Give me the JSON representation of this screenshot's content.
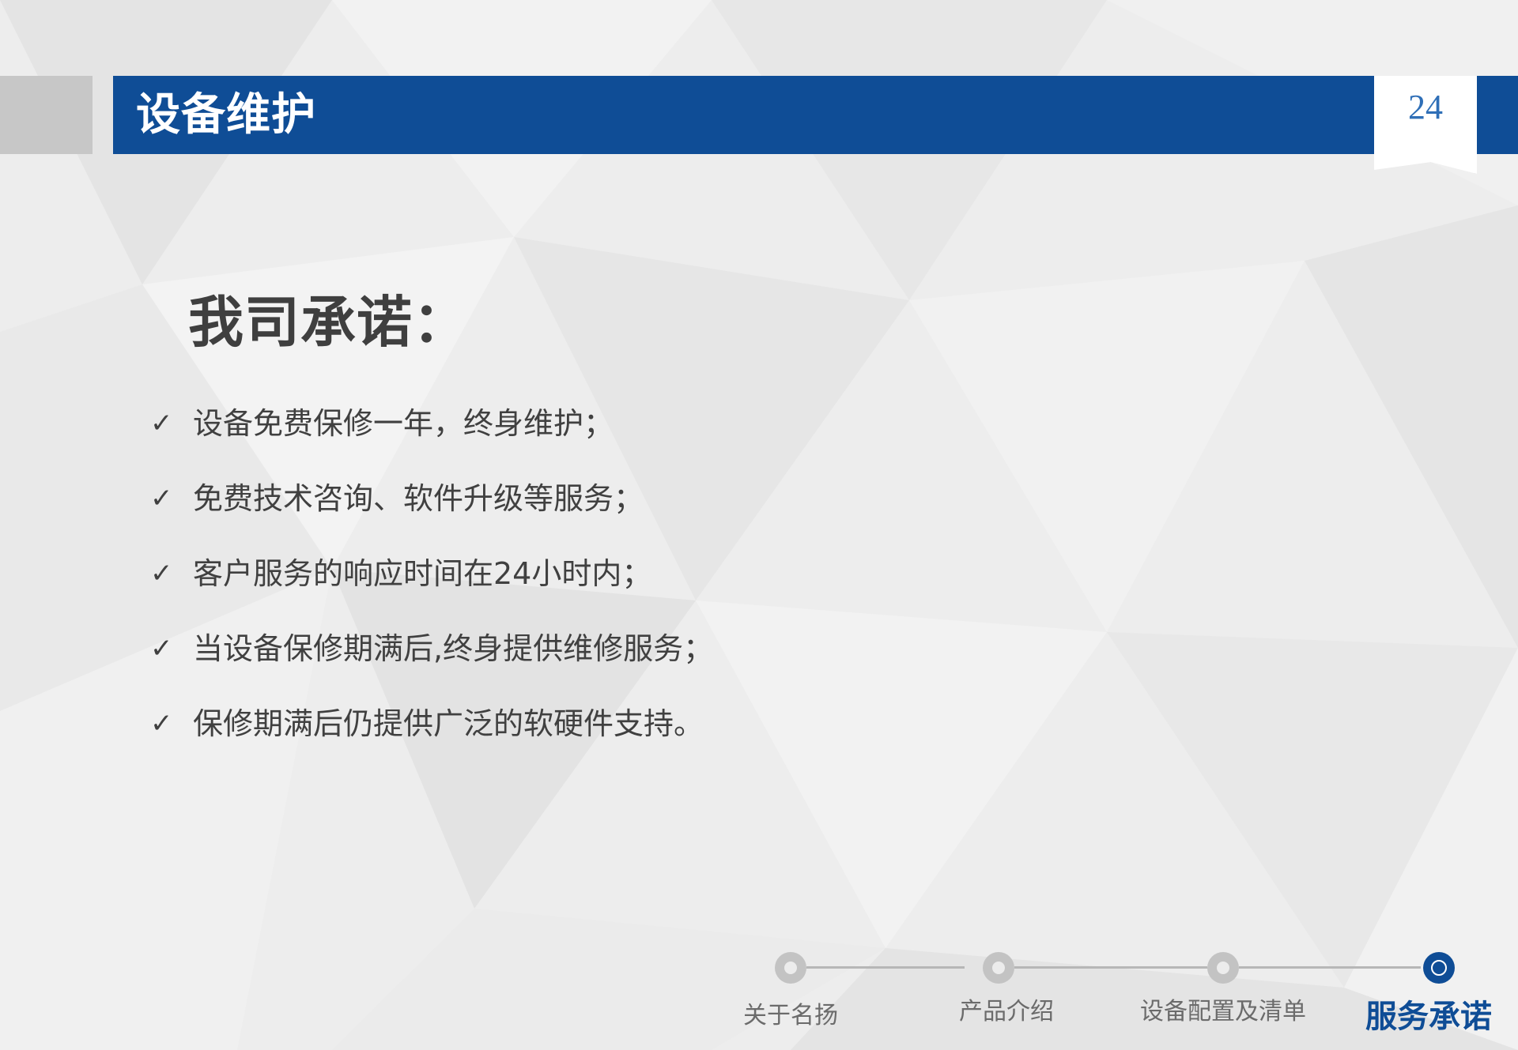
{
  "header": {
    "title": "设备维护",
    "page_number": "24"
  },
  "content": {
    "heading": "我司承诺：",
    "check_symbol": "✓",
    "items": [
      "设备免费保修一年，终身维护；",
      "免费技术咨询、软件升级等服务；",
      "客户服务的响应时间在24小时内；",
      "当设备保修期满后,终身提供维修服务；",
      "保修期满后仍提供广泛的软硬件支持。"
    ]
  },
  "progress": {
    "steps": [
      {
        "label": "关于名扬",
        "active": false
      },
      {
        "label": "产品介绍",
        "active": false
      },
      {
        "label": "设备配置及清单",
        "active": false
      },
      {
        "label": "服务承诺",
        "active": true
      }
    ]
  },
  "colors": {
    "brand_blue": "#0f4d96",
    "header_grey": "#c7c7c7",
    "text": "#404040"
  }
}
